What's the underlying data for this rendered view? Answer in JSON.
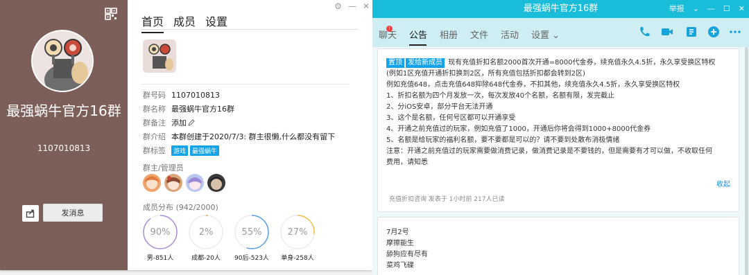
{
  "profile": {
    "group_name": "最强蜗牛官方16群",
    "group_number": "1107010813",
    "send_message_label": "发消息",
    "tabs": [
      "首页",
      "成员",
      "设置"
    ],
    "info": {
      "number_key": "群号码",
      "number_val": "1107010813",
      "name_key": "群名称",
      "name_val": "最强蜗牛官方16群",
      "remark_key": "群备注",
      "remark_val": "添加",
      "intro_key": "群介绍",
      "intro_val": "本群创建于2020/7/3: 群主很懒,什么都没有留下",
      "tags_key": "群标签",
      "tags": [
        "游戏",
        "最强蜗牛"
      ]
    },
    "admins_label": "群主/管理员",
    "distribution_label": "成员分布 (942/2000)",
    "rings": [
      {
        "percent": "90%",
        "value": 0.9,
        "caption": "男-851人",
        "color": "#a88fd8"
      },
      {
        "percent": "2%",
        "value": 0.02,
        "caption": "成都-20人",
        "color": "#f0a04c"
      },
      {
        "percent": "55%",
        "value": 0.55,
        "caption": "90后-523人",
        "color": "#5aa0e6"
      },
      {
        "percent": "27%",
        "value": 0.27,
        "caption": "单身-258人",
        "color": "#f2c04a"
      }
    ]
  },
  "chat": {
    "title": "最强蜗牛官方16群",
    "report_label": "举报",
    "tabs": [
      "聊天",
      "公告",
      "相册",
      "文件",
      "活动",
      "设置 ⌄"
    ],
    "badge": "!",
    "notice": {
      "tags": [
        "置顶",
        "发给新成员"
      ],
      "lines": [
        "现有充值折扣名额2000首次开通=8000代金券，续充值永久4.5折，永久享受换区特权",
        "(例如1区充值开通折扣换到2区，所有充值包括折扣都会转到2区)",
        "例如充值648，点击充值648抑除648代金券，不扣其他，续充值永久4.5折，永久享受换区特权",
        "1、折扣名额为四个月发放一次，每次发放40个名额，名额有限，发完截止",
        "2、分iOS安卓，部分平台无法开通",
        "3、这个是名额，任何号区都可以开通享受",
        "4、开通之前充值过的玩家，例如充值了1000，开通后你将会得到1000+8000代金券",
        "5、名额是给玩家的福利名额，要不要都是可以的？请不要到处散布消极情绪",
        "注意：开通之前充值过的玩家需要做消费记录，做消费记录是不要钱的，但是需要有才可以做，不收取任何",
        "费用，请知悉"
      ],
      "collapse": "收起",
      "meta": "充值折扣咨询  发表于 1小时前  217人已读"
    },
    "notice2": {
      "lines": [
        "7月2号",
        "摩擦能生",
        "舔狗应有尽有",
        "菜鸡飞碟"
      ]
    }
  }
}
